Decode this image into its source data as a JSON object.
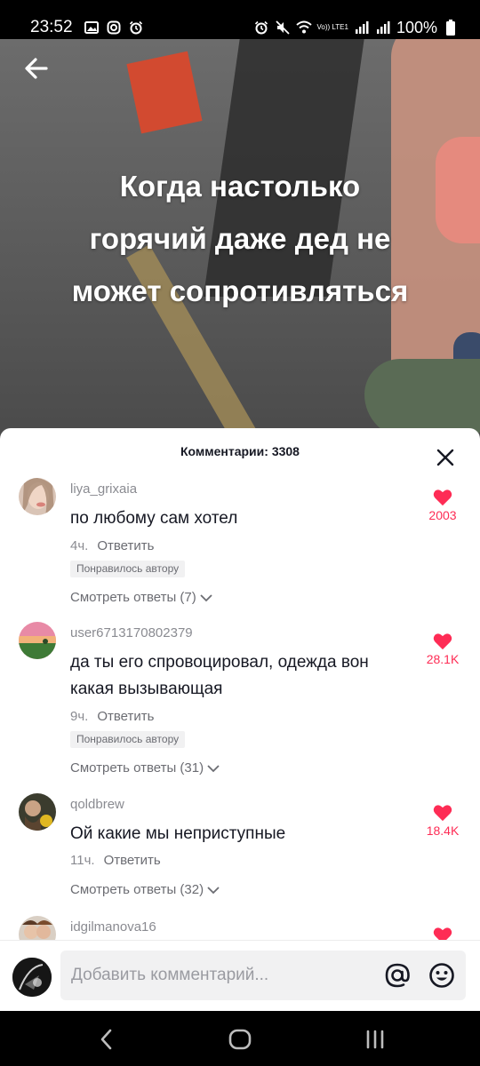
{
  "status_bar": {
    "time": "23:52",
    "battery": "100%",
    "left_icons": [
      "gallery-icon",
      "instagram-icon",
      "alarm-icon"
    ],
    "right_icons": [
      "alarm-icon",
      "mute-icon",
      "wifi-icon",
      "volte-icon",
      "signal-icon",
      "signal-icon",
      "battery-icon"
    ],
    "volte_label": "Vo)) LTE1"
  },
  "video": {
    "caption_lines": [
      "Когда настолько",
      "горячий даже дед не",
      "может сопротивляться"
    ]
  },
  "comments_sheet": {
    "title": "Комментарии: 3308",
    "accent_color": "#fe2c55",
    "comments": [
      {
        "username": "liya_grixaia",
        "text": "по любому сам хотел",
        "time": "4ч.",
        "reply_label": "Ответить",
        "badge": "Понравилось автору",
        "view_replies": "Смотреть ответы (7)",
        "likes": "2003"
      },
      {
        "username": "user6713170802379",
        "text": "да ты его спровоцировал, одежда вон какая вызывающая",
        "time": "9ч.",
        "reply_label": "Ответить",
        "badge": "Понравилось автору",
        "view_replies": "Смотреть ответы (31)",
        "likes": "28.1K"
      },
      {
        "username": "qoldbrew",
        "text": "Ой какие мы неприступные",
        "time": "11ч.",
        "reply_label": "Ответить",
        "view_replies": "Смотреть ответы (32)",
        "likes": "18.4K"
      },
      {
        "username": "idgilmanova16"
      }
    ]
  },
  "input_bar": {
    "placeholder": "Добавить комментарий..."
  }
}
